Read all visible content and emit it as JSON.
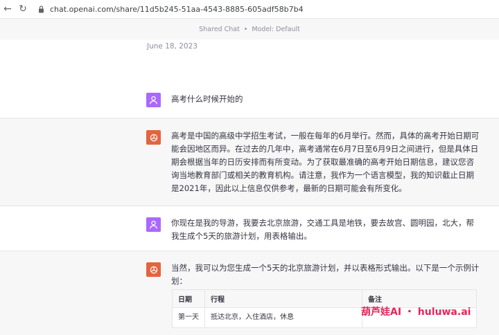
{
  "browser": {
    "url": "chat.openai.com/share/11d5b245-51aa-4543-8885-605adf58b7b4"
  },
  "header": {
    "shared": "Shared Chat",
    "separator": "•",
    "model": "Model: Default"
  },
  "date": "June 18, 2023",
  "messages": [
    {
      "role": "user",
      "text": "高考什么时候开始的"
    },
    {
      "role": "assistant",
      "text": "高考是中国的高级中学招生考试，一般在每年的6月举行。然而，具体的高考开始日期可能会因地区而异。在过去的几年中，高考通常在6月7日至6月9日之间进行，但是具体日期会根据当年的日历安排而有所变动。为了获取最准确的高考开始日期信息，建议您咨询当地教育部门或相关的教育机构。请注意，我作为一个语言模型，我的知识截止日期是2021年，因此以上信息仅供参考，最新的日期可能会有所变化。"
    },
    {
      "role": "user",
      "text": "你现在是我的导游，我要去北京旅游，交通工具是地铁，要去故宫、圆明园，北大，帮我生成个5天的旅游计划，用表格输出。"
    },
    {
      "role": "assistant",
      "text": "当然，我可以为您生成一个5天的北京旅游计划，并以表格形式输出。以下是一个示例计划："
    }
  ],
  "table": {
    "headers": [
      "日期",
      "行程",
      "备注"
    ],
    "rows": [
      {
        "date": "第一天",
        "plan": "抵达北京，入住酒店，休息",
        "note": ""
      }
    ]
  },
  "watermark": "葫芦娃AI ・ huluwa.ai",
  "colors": {
    "user_avatar": "#ab68ff",
    "assistant_avatar": "#e2653f",
    "accent_watermark": "#e4265a"
  }
}
